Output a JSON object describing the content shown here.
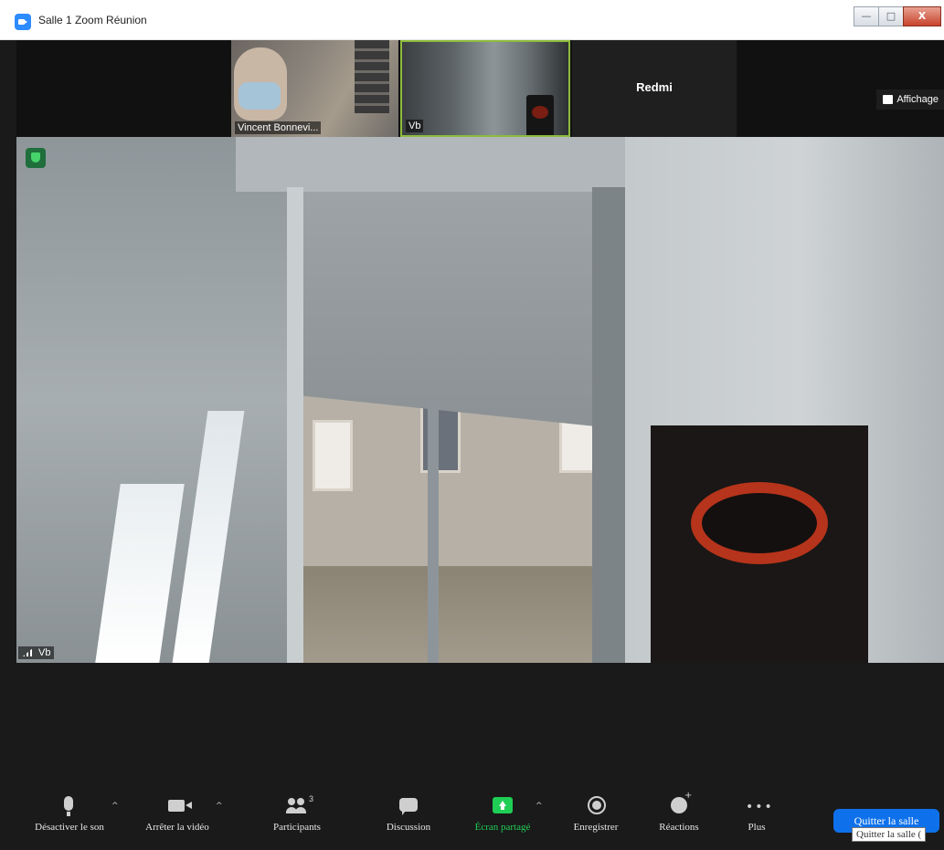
{
  "window": {
    "title": "Salle 1   Zoom Réunion",
    "controls": {
      "minimize": "—",
      "maximize": "□",
      "close": "X"
    }
  },
  "gallery": {
    "thumbnails": [
      {
        "name": "Vincent Bonnevi..."
      },
      {
        "name": "Vb"
      },
      {
        "name": "Redmi"
      }
    ],
    "view_button": "Affichage"
  },
  "main_video": {
    "participant": "Vb"
  },
  "toolbar": {
    "mute": "Désactiver le son",
    "video": "Arrêter la vidéo",
    "participants": "Participants",
    "participants_count": "3",
    "chat": "Discussion",
    "share": "Écran partagé",
    "record": "Enregistrer",
    "reactions": "Réactions",
    "more": "Plus",
    "leave": "Quitter la salle",
    "leave_tooltip": "Quitter la salle (",
    "caret": "^",
    "more_glyph": "•••"
  },
  "colors": {
    "accent_blue": "#0e71eb",
    "share_green": "#1fce55",
    "active_speaker_border": "#8dbb3c"
  }
}
